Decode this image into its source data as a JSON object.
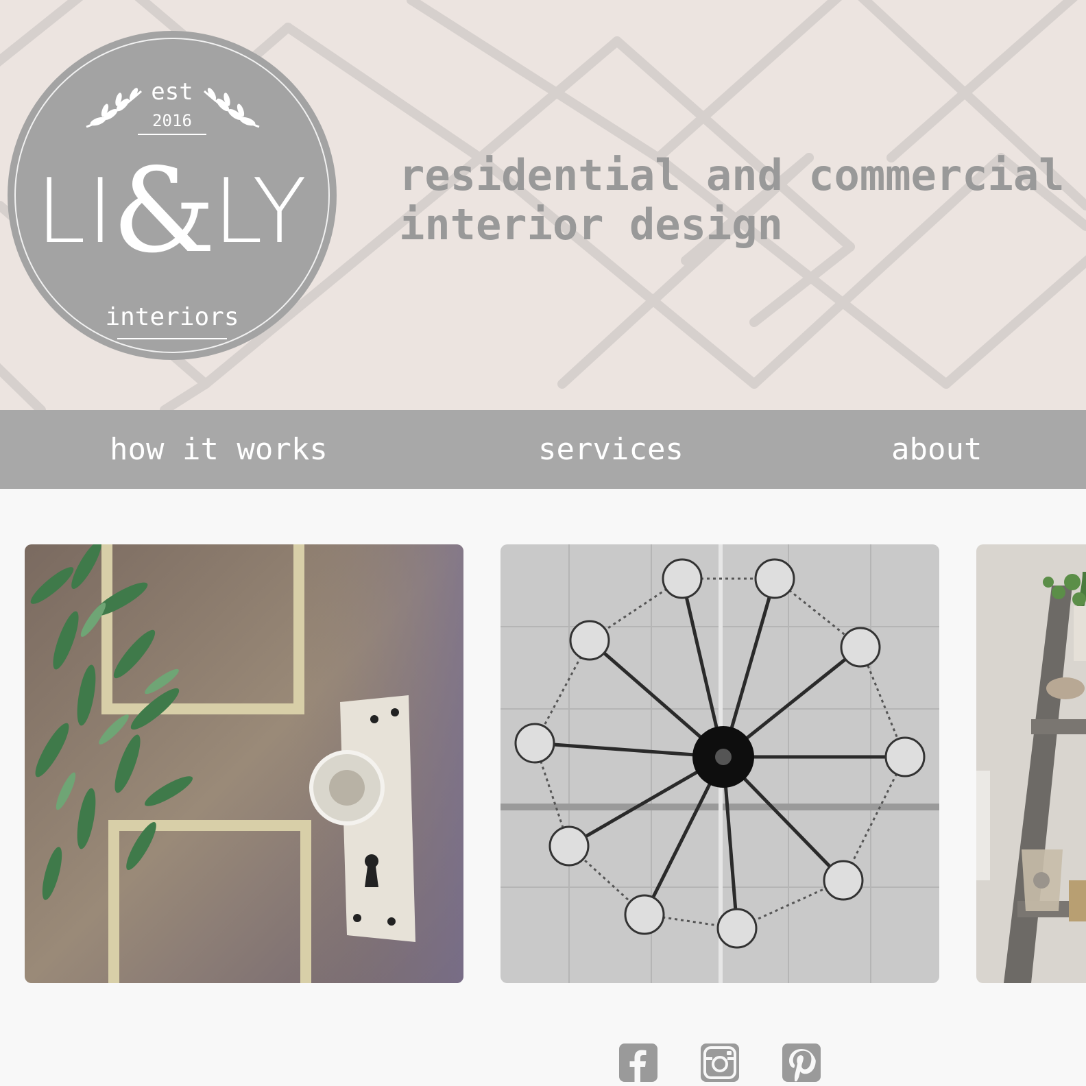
{
  "logo": {
    "est": "est",
    "year": "2016",
    "brand_left": "LI",
    "brand_amp": "&",
    "brand_right": "LY",
    "sub": "interiors"
  },
  "tagline": {
    "line1": "residential and commercial",
    "line2": "interior design"
  },
  "nav": {
    "items": [
      {
        "label": "how it works"
      },
      {
        "label": "services"
      },
      {
        "label": "about"
      }
    ]
  },
  "gallery": {
    "items": [
      {
        "subject": "door with glass knob and greenery"
      },
      {
        "subject": "crystal chandelier"
      },
      {
        "subject": "ladder shelf with plants"
      }
    ]
  },
  "social": {
    "icons": [
      "facebook-icon",
      "instagram-icon",
      "pinterest-icon"
    ]
  },
  "colors": {
    "header_bg": "#ece4e0",
    "logo_gray": "#a3a3a3",
    "nav_bg": "#a8a8a8",
    "tagline_text": "#999999",
    "page_bg": "#f8f8f8"
  }
}
